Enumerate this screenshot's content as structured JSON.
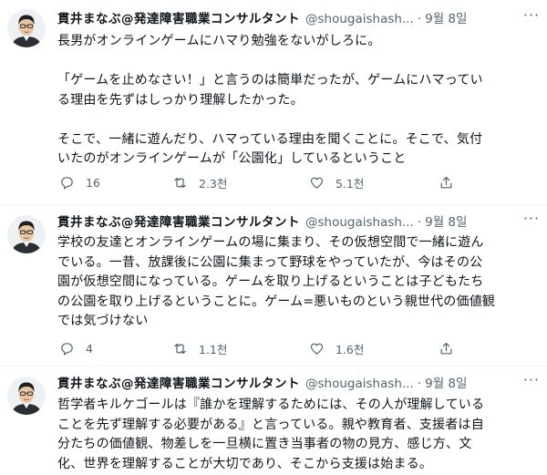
{
  "tweets": [
    {
      "author_name": "貫井まなぶ@発達障害職業コンサルタント",
      "handle": "@shougaishash...",
      "separator": "·",
      "date": "9월 8일",
      "lines": [
        "長男がオンラインゲームにハマり勉強をないがしろに。",
        "",
        "「ゲームを止めなさい！」と言うのは簡単だったが、ゲームにハマってい",
        "る理由を先ずはしっかり理解したかった。",
        "",
        "そこで、一緒に遊んだり、ハマっている理由を聞くことに。そこで、気付",
        "いたのがオンラインゲームが「公園化」しているということ"
      ],
      "replies": "16",
      "retweets": "2.3천",
      "likes": "5.1천"
    },
    {
      "author_name": "貫井まなぶ@発達障害職業コンサルタント",
      "handle": "@shougaishash...",
      "separator": "·",
      "date": "9월 8일",
      "lines": [
        "学校の友達とオンラインゲームの場に集まり、その仮想空間で一緒に遊ん",
        "でいる。一昔、放課後に公園に集まって野球をやっていたが、今はその公",
        "園が仮想空間になっている。ゲームを取り上げるということは子どもたち",
        "の公園を取り上げるということに。ゲーム=悪いものという親世代の価値観",
        "では気づけない"
      ],
      "replies": "4",
      "retweets": "1.1천",
      "likes": "1.6천"
    },
    {
      "author_name": "貫井まなぶ@発達障害職業コンサルタント",
      "handle": "@shougaishash...",
      "separator": "·",
      "date": "9월 8일",
      "lines": [
        "哲学者キルケゴールは『誰かを理解するためには、その人が理解している",
        "ことを先ず理解する必要がある』と言っている。親や教育者、支援者は自",
        "分たちの価値観、物差しを一旦横に置き当事者の物の見方、感じ方、文",
        "化、世界を理解することが大切であり、そこから支援は始まる。"
      ]
    }
  ],
  "icons": {
    "more": "more-icon",
    "reply": "reply-icon",
    "retweet": "retweet-icon",
    "like": "like-icon",
    "share": "share-icon"
  }
}
